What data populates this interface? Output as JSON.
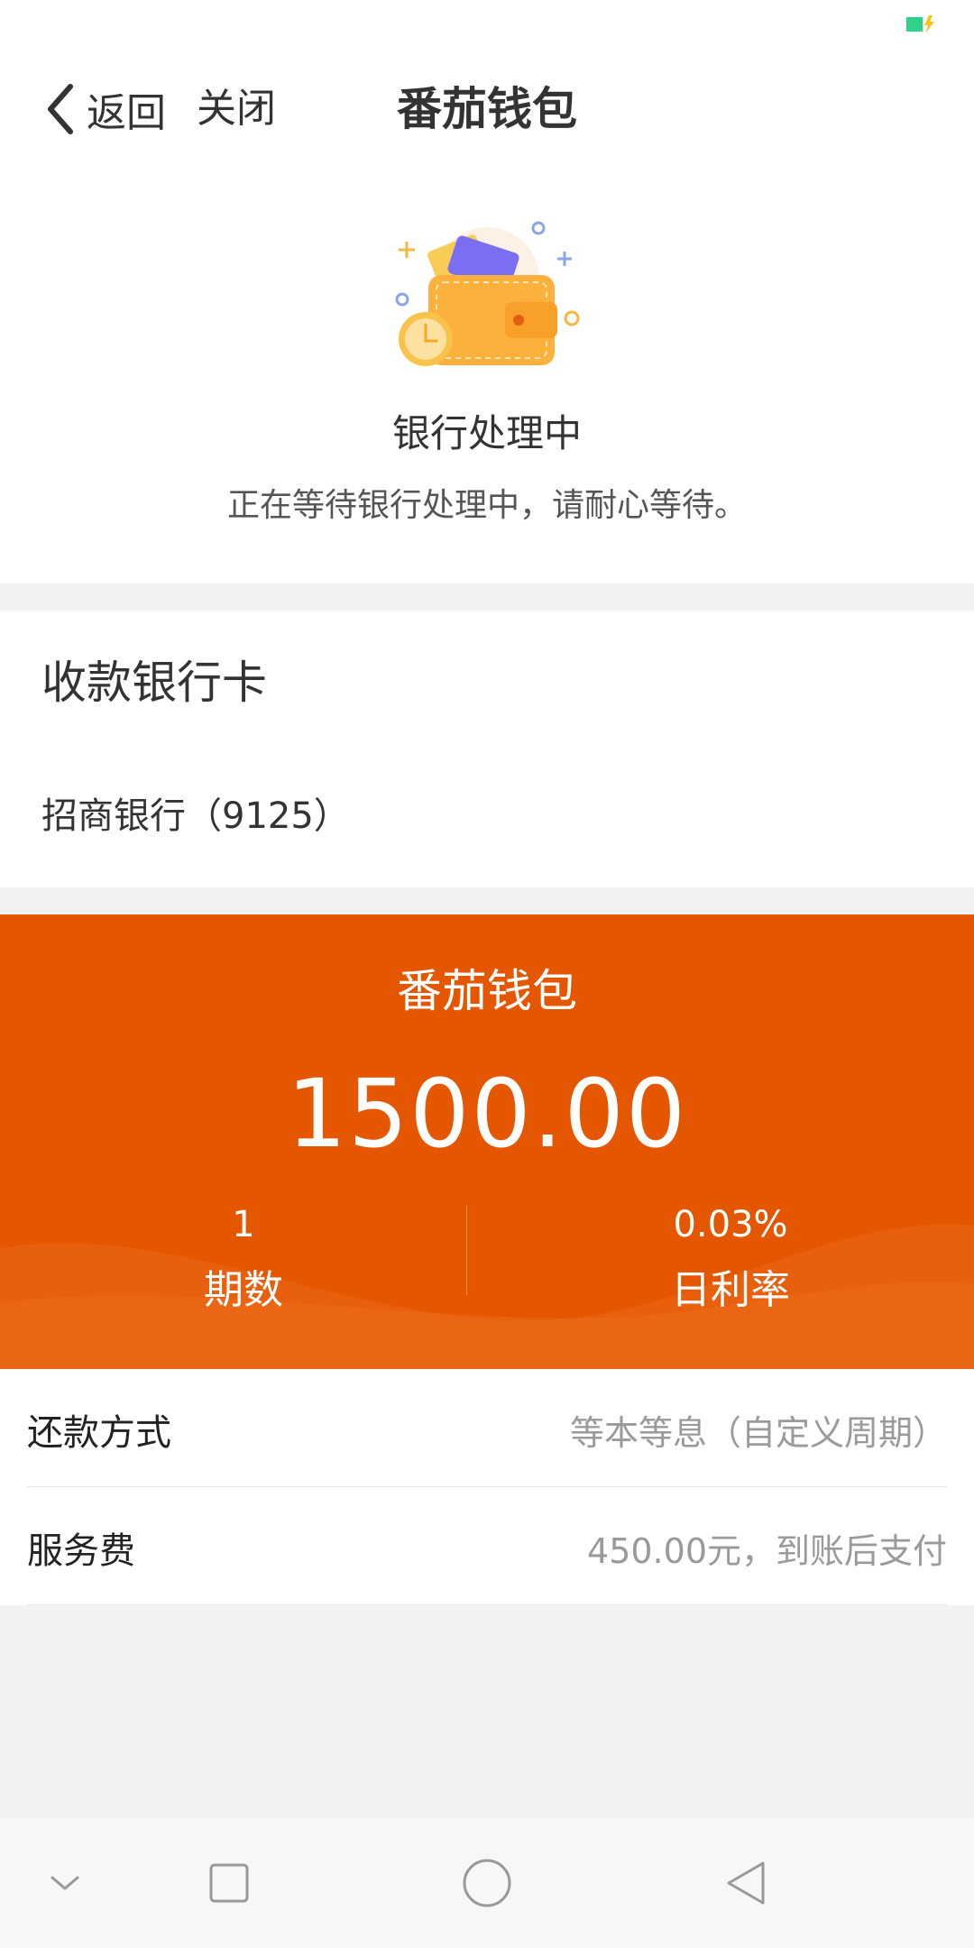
{
  "header": {
    "back_label": "返回",
    "close_label": "关闭",
    "title": "番茄钱包"
  },
  "status": {
    "title": "银行处理中",
    "description": "正在等待银行处理中，请耐心等待。"
  },
  "bank_card": {
    "heading": "收款银行卡",
    "bank_name": "招商银行（9125）"
  },
  "loan": {
    "product_name": "番茄钱包",
    "amount": "1500.00",
    "term_value": "1",
    "term_label": "期数",
    "rate_value": "0.03%",
    "rate_label": "日利率"
  },
  "details": {
    "repayment_label": "还款方式",
    "repayment_value": "等本等息（自定义周期）",
    "fee_label": "服务费",
    "fee_value": "450.00元，到账后支付"
  },
  "colors": {
    "accent": "#e55600",
    "battery": "#2ed38a",
    "charge_bolt": "#f5c518"
  }
}
